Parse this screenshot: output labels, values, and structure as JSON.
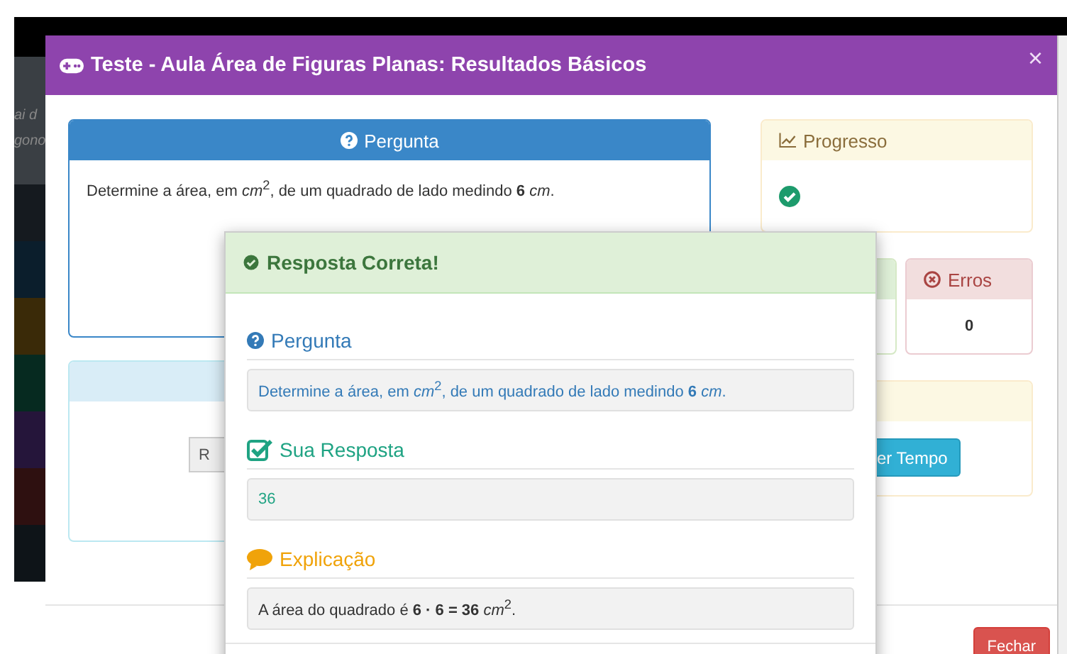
{
  "backdrop_fragments": [
    "ai d",
    "gono"
  ],
  "modal": {
    "title": "Teste - Aula Área de Figuras Planas: Resultados Básicos",
    "close": "×",
    "question_panel": {
      "heading": "Pergunta",
      "text": "Determine a área, em *cm*$^{2}$, de um quadrado de lado medindo **6** *cm*."
    },
    "second_panel": {
      "button": "R"
    },
    "progress_panel": {
      "heading": "Progresso",
      "completed": true
    },
    "errors_panel": {
      "heading": "Erros",
      "value": "0"
    },
    "time_panel": {
      "button": "er Tempo"
    },
    "footer_button": "Fechar"
  },
  "result_popup": {
    "title": "Resposta Correta!",
    "correct": true,
    "sections": [
      {
        "kind": "question",
        "heading": "Pergunta",
        "text": "Determine a área, em *cm*$^{2}$, de um quadrado de lado medindo **6** *cm*."
      },
      {
        "kind": "answer",
        "heading": "Sua Resposta",
        "text": "36"
      },
      {
        "kind": "explanation",
        "heading": "Explicação",
        "text": "A área do quadrado é **6 · 6 = 36** *cm*$^{2}$."
      }
    ]
  }
}
